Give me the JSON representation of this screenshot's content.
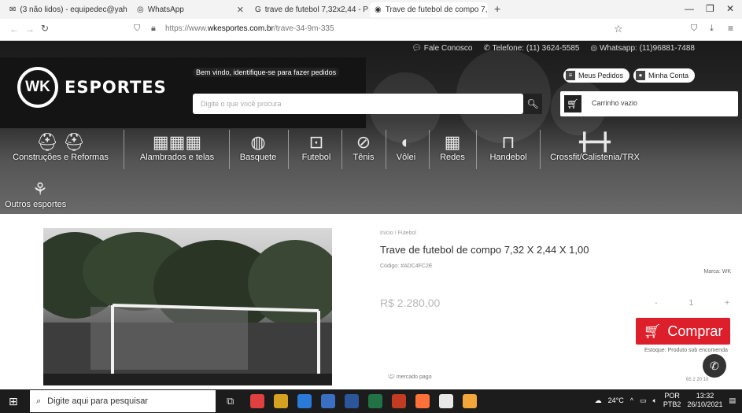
{
  "browser": {
    "tabs": [
      {
        "title": "(3 não lidos) - equipedec@yah",
        "icon": "mail-icon"
      },
      {
        "title": "WhatsApp",
        "icon": "whatsapp-icon"
      },
      {
        "title": "trave de futebol 7,32x2,44 - Pes",
        "icon": "google-icon"
      },
      {
        "title": "Trave de futebol de compo 7,3",
        "icon": "site-icon"
      }
    ],
    "new_tab": "+",
    "url_prefix": "https://www.",
    "url_host": "wkesportes.com.br",
    "url_path": "/trave-34-9m-335"
  },
  "site": {
    "top_links": [
      "Fale Conosco",
      "Telefone: (11) 3624-5585",
      "Whatsapp: (11)96881-7488"
    ],
    "logo_mark": "WK",
    "logo_name": "ESPORTES",
    "welcome": "Bem vindo, identifique-se para fazer pedidos",
    "search_placeholder": "Digite o que você procura",
    "my_orders": "Meus Pedidos",
    "my_account": "Minha Conta",
    "cart": "Carrinho vazio",
    "categories": [
      "Construções e Reformas",
      "Alambrados e telas",
      "Basquete",
      "Futebol",
      "Tênis",
      "Vôlei",
      "Redes",
      "Handebol",
      "Crossfit/Calistenia/TRX",
      "Outros esportes"
    ]
  },
  "product": {
    "breadcrumb": "Início / Futebol",
    "title": "Trave de futebol de compo 7,32 X 2,44 X 1,00",
    "code": "Código: #ADC4FC2E",
    "brand": "Marca: WK",
    "price": "R$ 2.280,00",
    "qty_minus": "-",
    "qty_value": "1",
    "qty_plus": "+",
    "buy": "Comprar",
    "stock": "Estoque: Produto sob encomenda",
    "payment": "mercado pago",
    "whatsapp_caption": "65 2 20 10"
  },
  "taskbar": {
    "search": "Digite aqui para pesquisar",
    "weather": "24°C",
    "lang": "POR",
    "lang2": "PTB2",
    "time": "13:32",
    "date": "26/10/2021"
  }
}
